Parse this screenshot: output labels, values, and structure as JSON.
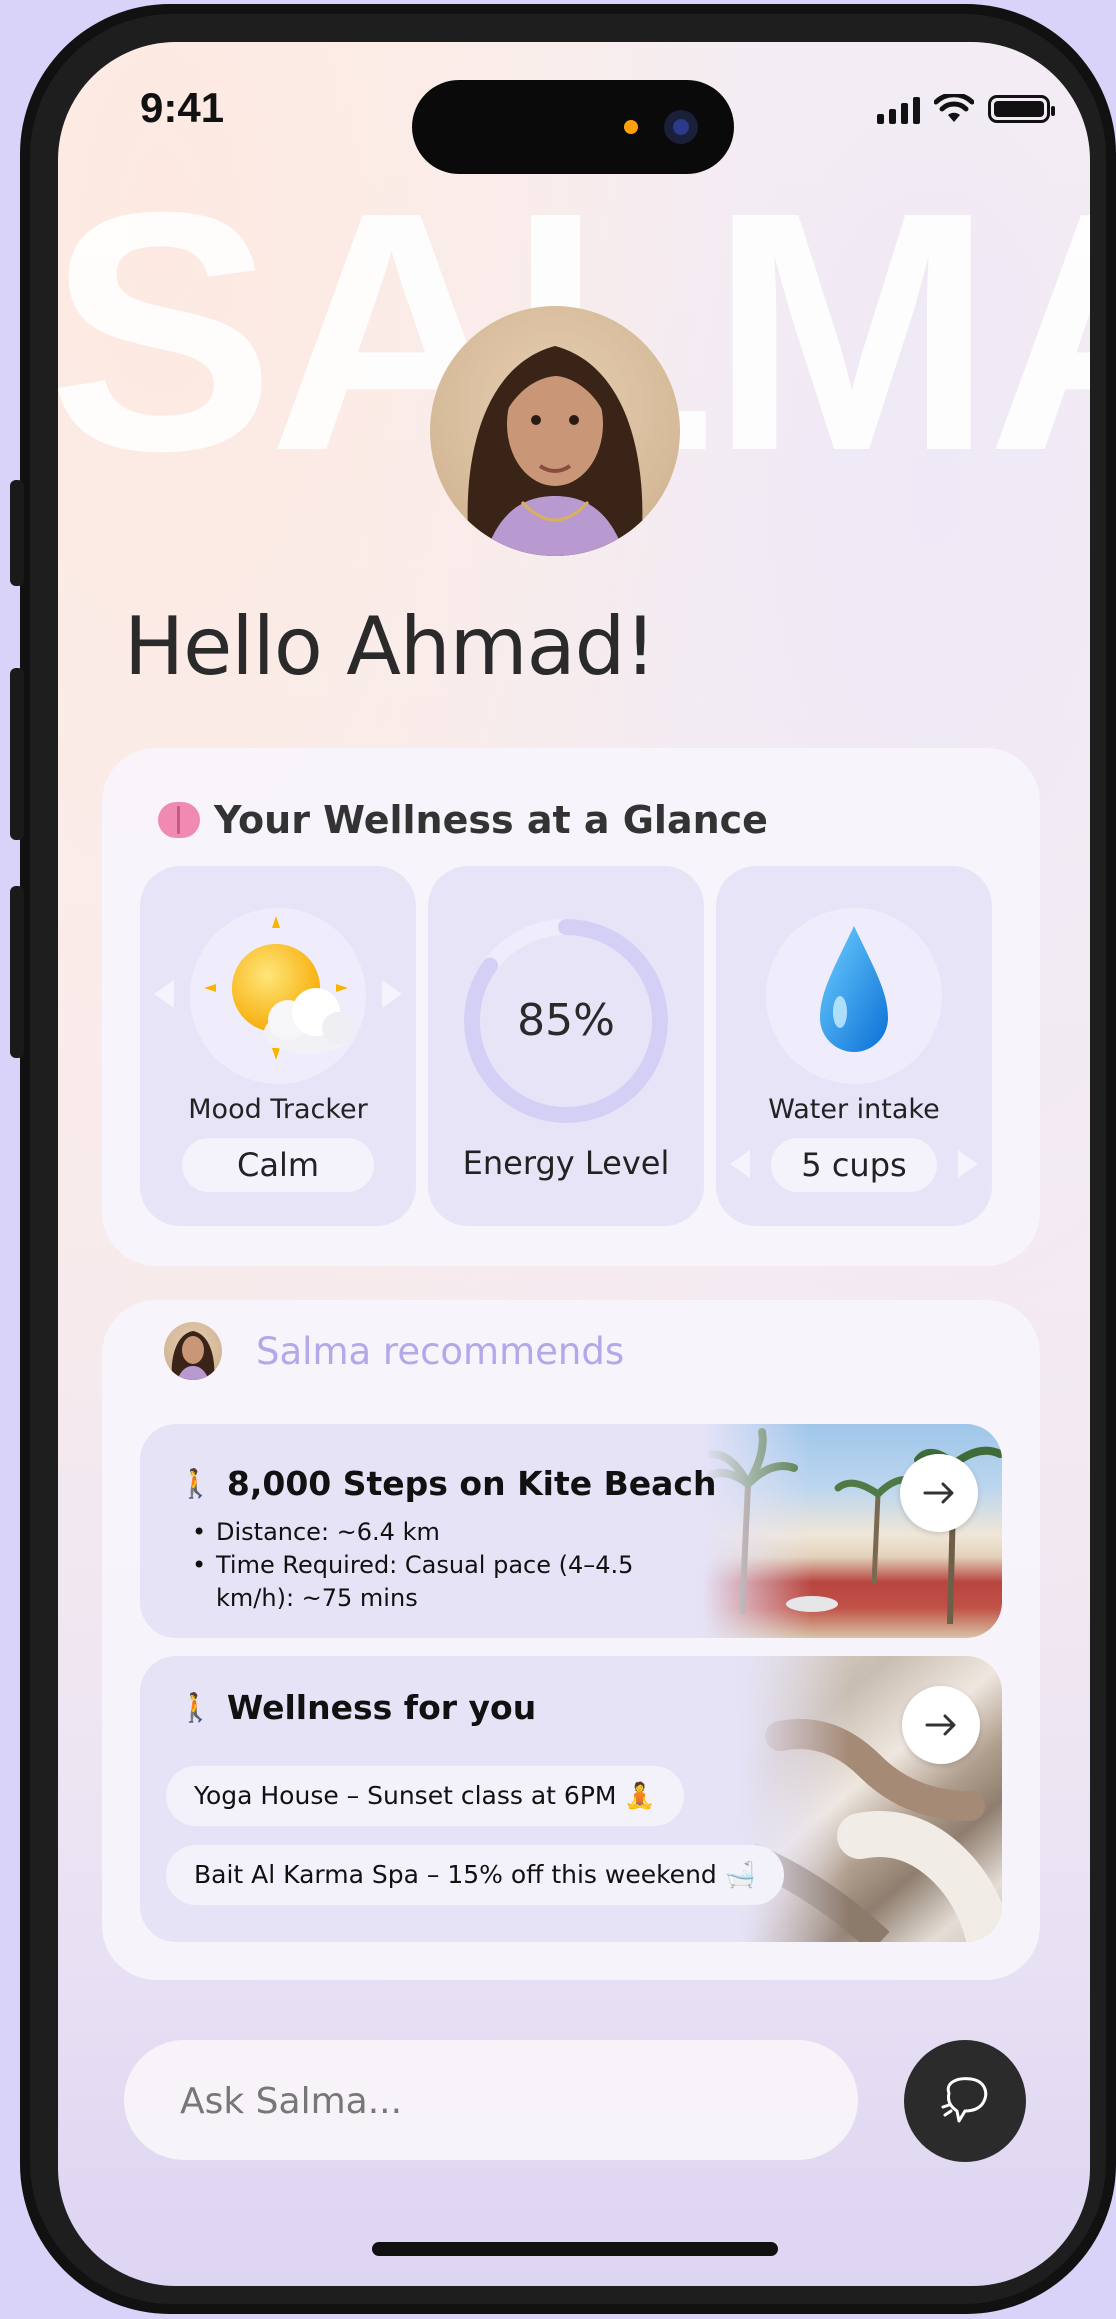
{
  "status_bar": {
    "time": "9:41"
  },
  "watermark_text": "SALMA",
  "greeting": "Hello Ahmad!",
  "wellness": {
    "title": "Your Wellness at a Glance",
    "title_icon": "brain-icon",
    "mood": {
      "label": "Mood Tracker",
      "value": "Calm",
      "icon": "sun-behind-cloud-icon"
    },
    "energy": {
      "percent_text": "85%",
      "percent": 85,
      "label": "Energy Level"
    },
    "water": {
      "label": "Water intake",
      "value": "5 cups",
      "icon": "droplet-icon"
    }
  },
  "recommendations": {
    "header": "Salma recommends",
    "steps": {
      "title": "8,000 Steps on Kite Beach",
      "bullets": [
        "Distance: ~6.4 km",
        "Time Required:  Casual pace (4–4.5 km/h): ~75 mins"
      ]
    },
    "wellness_for_you": {
      "title": "Wellness for you",
      "tags": [
        "Yoga House – Sunset class at 6PM 🧘",
        "Bait Al Karma Spa – 15% off this weekend 🛁"
      ]
    }
  },
  "ask": {
    "placeholder": "Ask Salma..."
  },
  "colors": {
    "accent": "#b6a6ea",
    "card_tile": "#e7e4f8",
    "send_button": "#2b2b2b"
  }
}
